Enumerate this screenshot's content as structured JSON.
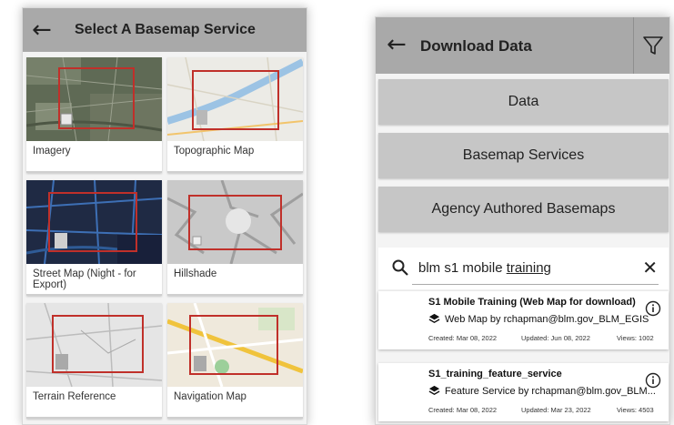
{
  "left_screen": {
    "title": "Select A Basemap Service",
    "icons": {
      "back": "arrow-left-icon"
    },
    "cards": [
      {
        "label": "Imagery"
      },
      {
        "label": "Topographic Map"
      },
      {
        "label": "Street Map (Night - for Export)"
      },
      {
        "label": "Hillshade"
      },
      {
        "label": "Terrain Reference"
      },
      {
        "label": "Navigation Map"
      }
    ]
  },
  "right_screen": {
    "title": "Download Data",
    "icons": {
      "back": "arrow-left-icon",
      "filter": "filter-icon",
      "search": "search-icon",
      "clear": "close-icon",
      "info": "info-icon",
      "layers": "layers-icon"
    },
    "sections": [
      {
        "label": "Data"
      },
      {
        "label": "Basemap Services"
      },
      {
        "label": "Agency Authored Basemaps"
      }
    ],
    "search": {
      "value_prefix": "blm s1 mobile ",
      "value_underlined": "training"
    },
    "results": [
      {
        "title": "S1 Mobile Training (Web Map for download)",
        "type_line": "Web Map by rchapman@blm.gov_BLM_EGIS",
        "created": "Created: Mar 08, 2022",
        "updated": "Updated: Jun 08, 2022",
        "views": "Views: 1002"
      },
      {
        "title": "S1_training_feature_service",
        "type_line": "Feature Service by rchapman@blm.gov_BLM...",
        "created": "Created: Mar 08, 2022",
        "updated": "Updated: Mar 23, 2022",
        "views": "Views: 4503"
      }
    ]
  },
  "colors": {
    "header": "#a9a9a9",
    "section": "#c6c6c6",
    "frame_red": "#c0302a"
  }
}
